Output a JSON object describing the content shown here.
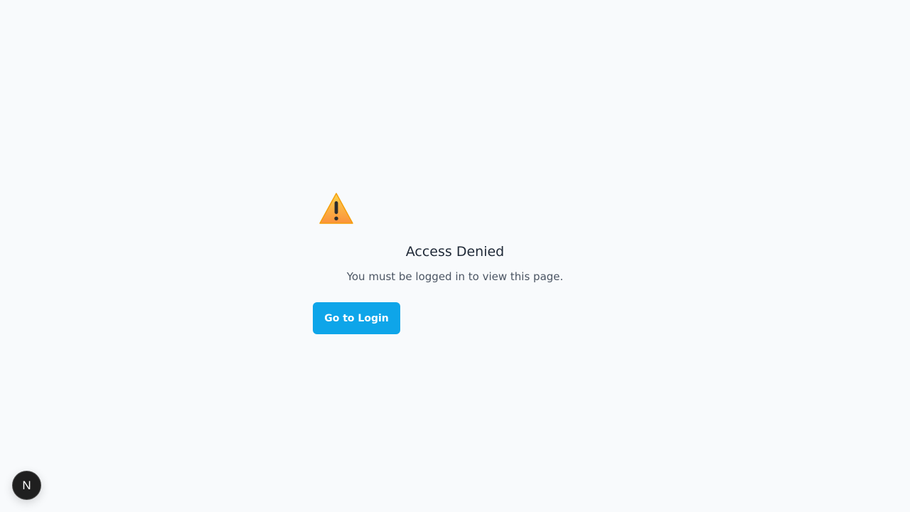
{
  "panel": {
    "icon": "warning-icon",
    "title": "Access Denied",
    "message": "You must be logged in to view this page.",
    "login_button_label": "Go to Login"
  },
  "dev_badge": {
    "label": "N",
    "icon": "next-logo-icon"
  },
  "colors": {
    "background": "#f8fafc",
    "accent": "#0ea5e9",
    "warning": "#fbbf24"
  }
}
